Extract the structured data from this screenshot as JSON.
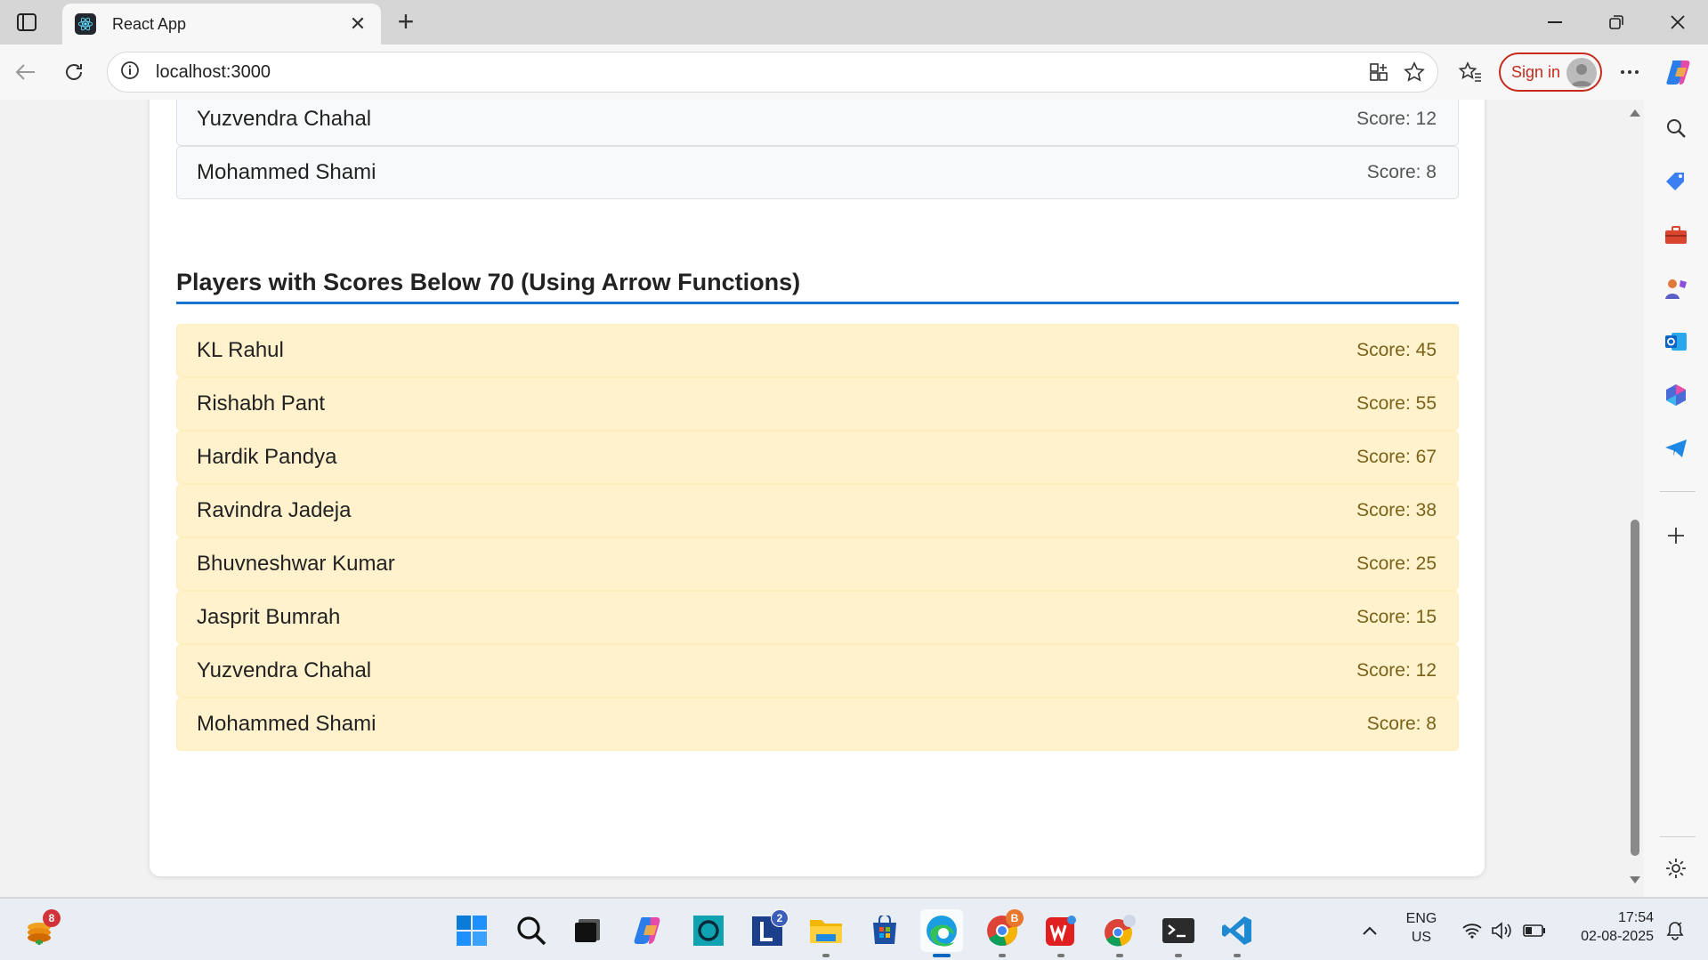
{
  "browser": {
    "tab_title": "React App",
    "url": "localhost:3000",
    "sign_in_label": "Sign in"
  },
  "page": {
    "top_rows": [
      {
        "name": "Yuzvendra Chahal",
        "score": "Score: 12"
      },
      {
        "name": "Mohammed Shami",
        "score": "Score: 8"
      }
    ],
    "section_title": "Players with Scores Below 70 (Using Arrow Functions)",
    "low_rows": [
      {
        "name": "KL Rahul",
        "score": "Score: 45"
      },
      {
        "name": "Rishabh Pant",
        "score": "Score: 55"
      },
      {
        "name": "Hardik Pandya",
        "score": "Score: 67"
      },
      {
        "name": "Ravindra Jadeja",
        "score": "Score: 38"
      },
      {
        "name": "Bhuvneshwar Kumar",
        "score": "Score: 25"
      },
      {
        "name": "Jasprit Bumrah",
        "score": "Score: 15"
      },
      {
        "name": "Yuzvendra Chahal",
        "score": "Score: 12"
      },
      {
        "name": "Mohammed Shami",
        "score": "Score: 8"
      }
    ]
  },
  "taskbar": {
    "widgets_badge": "8",
    "lens_badge": "2",
    "chrome_badge": "B",
    "lang_top": "ENG",
    "lang_bottom": "US",
    "time": "17:54",
    "date": "02-08-2025"
  },
  "colors": {
    "accent_blue": "#1a73d2",
    "low_score_bg": "#fff2cd",
    "sign_in_red": "#c42b1c"
  }
}
